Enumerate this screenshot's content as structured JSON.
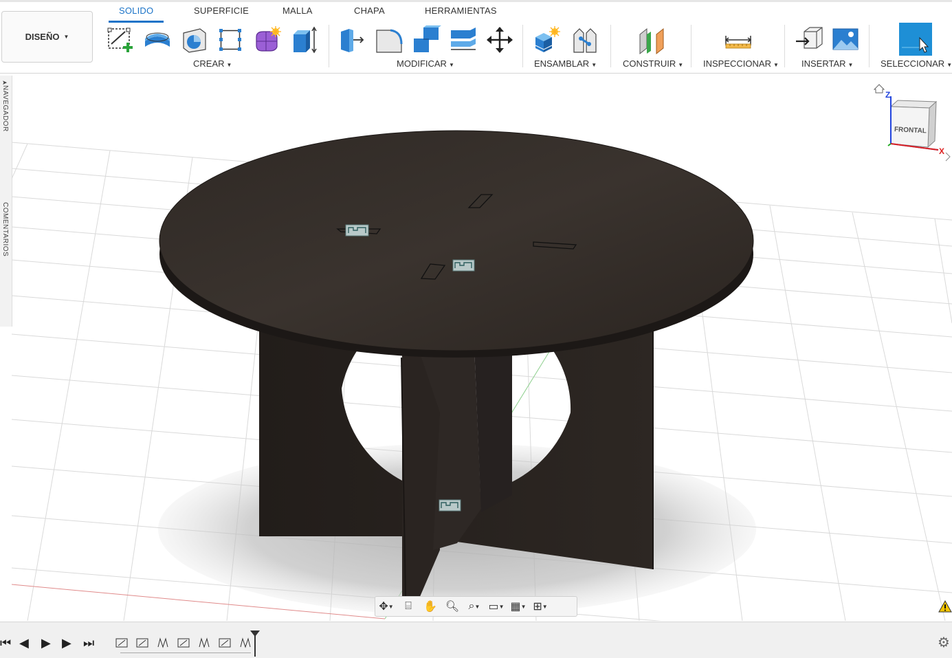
{
  "workspace": {
    "label": "DISEÑO"
  },
  "tabs": [
    {
      "label": "SOLIDO",
      "active": true
    },
    {
      "label": "SUPERFICIE",
      "active": false
    },
    {
      "label": "MALLA",
      "active": false
    },
    {
      "label": "CHAPA",
      "active": false
    },
    {
      "label": "HERRAMIENTAS",
      "active": false
    }
  ],
  "groups": {
    "crear": "CREAR",
    "modificar": "MODIFICAR",
    "ensamblar": "ENSAMBLAR",
    "construir": "CONSTRUIR",
    "inspeccionar": "INSPECCIONAR",
    "insertar": "INSERTAR",
    "seleccionar": "SELECCIONAR"
  },
  "side_panel": {
    "navigator": "NAVEGADOR",
    "comments": "COMENTARIOS"
  },
  "viewcube": {
    "face": "FRONTAL",
    "axis_z": "Z",
    "axis_x": "X"
  },
  "colors": {
    "accent": "#1a73c8",
    "wood": "#2b2622",
    "grid": "#d9d9d9",
    "select": "#1e8fd6"
  },
  "icons": {
    "timeline": [
      "skip-start-icon",
      "step-back-icon",
      "play-icon",
      "step-forward-icon",
      "skip-end-icon"
    ],
    "navbar": [
      "orbit-icon",
      "look-at-icon",
      "pan-icon",
      "zoom-icon",
      "zoom-window-icon",
      "display-settings-icon",
      "grid-icon",
      "viewports-icon"
    ]
  }
}
